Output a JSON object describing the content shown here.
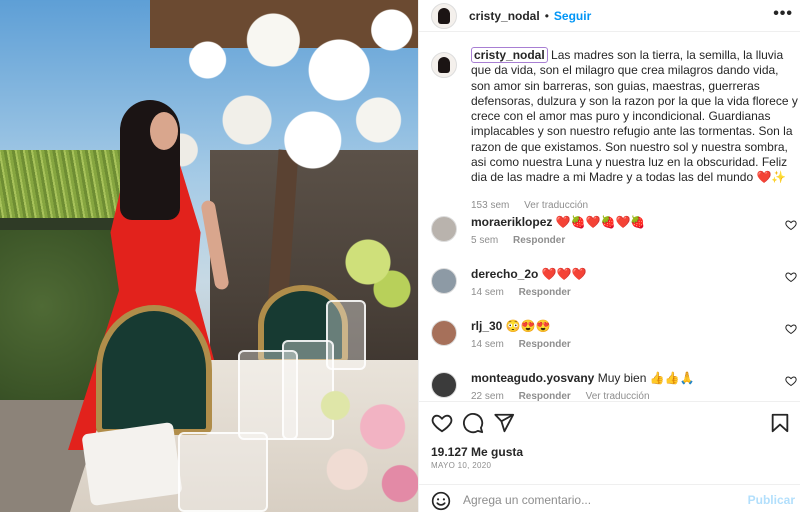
{
  "post": {
    "username": "cristy_nodal",
    "follow_label": "Seguir",
    "separator": "•",
    "more_label": "•••",
    "caption": "Las madres son la tierra, la semilla, la lluvia que da vida, son el milagro que crea milagros dando vida, son amor sin barreras, son guias, maestras, guerreras defensoras, dulzura y son la razon por la que la vida florece y crece con el amor mas puro y incondicional. Guardianas implacables y son nuestro refugio ante las tormentas. Son la razon de que existamos. Son nuestro sol y nuestra sombra, asi como nuestra Luna y nuestra luz en la obscuridad. Feliz dia de las madre a mi Madre y a todas las del mundo ❤️✨",
    "caption_age": "153 sem",
    "see_translation": "Ver traducción"
  },
  "comments": [
    {
      "user": "moraeriklopez",
      "text": "❤️🍓❤️🍓❤️🍓",
      "age": "5 sem",
      "reply": "Responder",
      "extra": ""
    },
    {
      "user": "derecho_2o",
      "text": "❤️❤️❤️",
      "age": "14 sem",
      "reply": "Responder",
      "extra": ""
    },
    {
      "user": "rlj_30",
      "text": "😳😍😍",
      "age": "14 sem",
      "reply": "Responder",
      "extra": ""
    },
    {
      "user": "monteagudo.yosvany",
      "text": "Muy bien 👍👍🙏",
      "age": "22 sem",
      "reply": "Responder",
      "extra": "Ver traducción"
    }
  ],
  "stats": {
    "likes": "19.127 Me gusta",
    "date": "MAYO 10, 2020"
  },
  "composer": {
    "placeholder": "Agrega un comentario...",
    "publish_label": "Publicar"
  },
  "colors": {
    "accent": "#0095f6",
    "publish_disabled": "#b2dffc",
    "muted": "#8e8e8e"
  },
  "icons": {
    "like": "heart-icon",
    "comment": "comment-icon",
    "share": "send-icon",
    "save": "bookmark-icon",
    "emoji": "emoji-icon"
  }
}
